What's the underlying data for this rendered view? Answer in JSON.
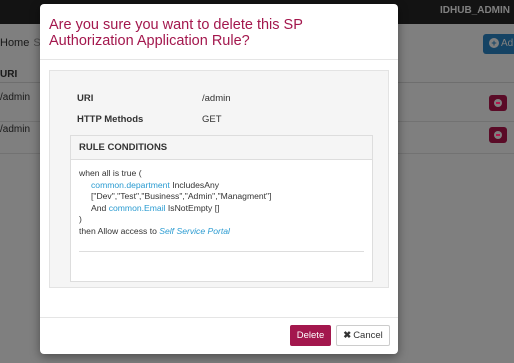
{
  "background": {
    "user_label": "IDHUB_ADMIN",
    "breadcrumb_home": "Home",
    "breadcrumb_sep": "S",
    "add_button_label": "Ad",
    "table_header": "URI",
    "rows": [
      {
        "uri": "/admin"
      },
      {
        "uri": "/admin"
      }
    ]
  },
  "modal": {
    "title": "Are you sure you want to delete this SP Authorization Application Rule?",
    "uri_label": "URI",
    "uri_value": "/admin",
    "methods_label": "HTTP Methods",
    "methods_value": "GET",
    "rule_conditions_heading": "RULE CONDITIONS",
    "rule": {
      "line1": "when all is true (",
      "attr1": "common.department",
      "op1": " IncludesAny",
      "values1": "[\"Dev\",\"Test\",\"Business\",\"Admin\",\"Managment\"]",
      "and_label": "And ",
      "attr2": "common.Email",
      "op2": " IsNotEmpty []",
      "close": ")",
      "then_text": "then Allow access to ",
      "portal_link": "Self Service Portal"
    },
    "delete_label": "Delete",
    "cancel_label": "Cancel"
  }
}
